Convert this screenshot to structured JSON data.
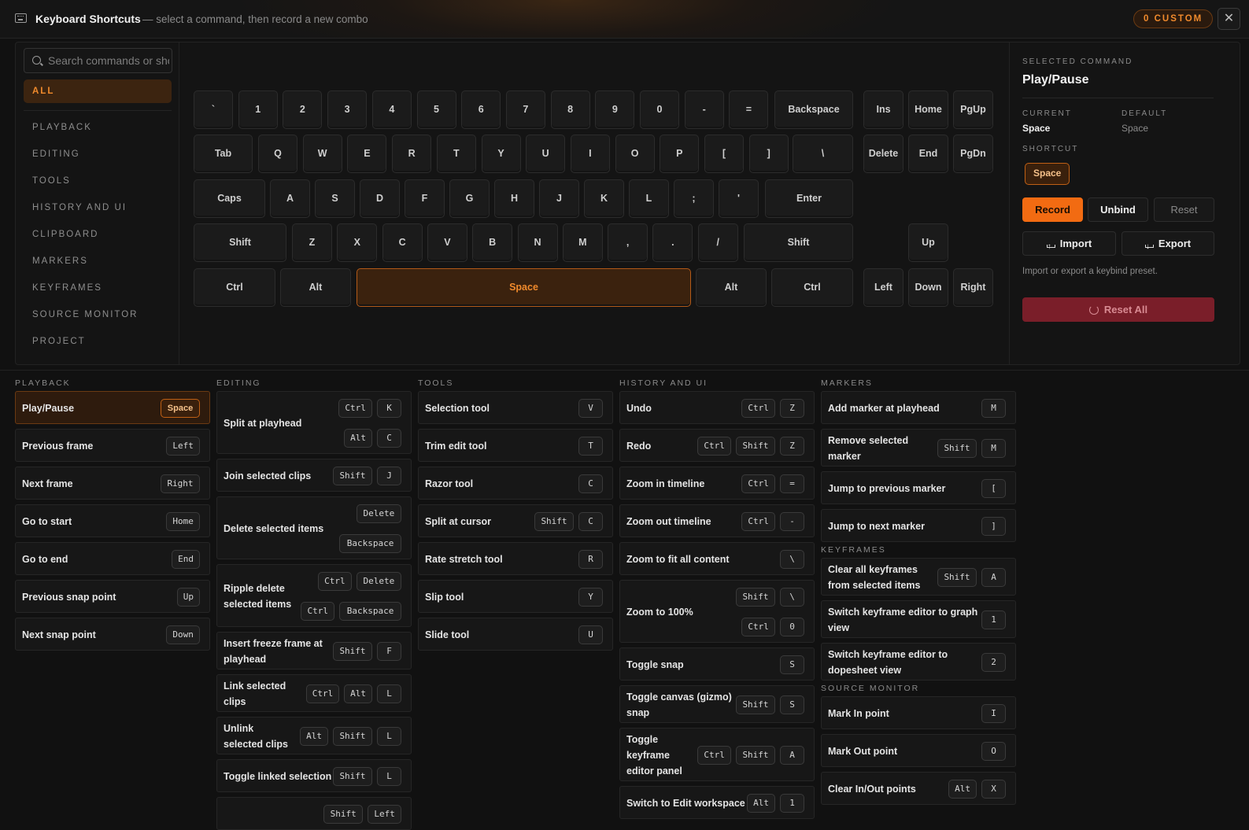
{
  "header": {
    "title": "Keyboard Shortcuts",
    "subtitle": "— select a command, then record a new combo",
    "custom_badge": "0 CUSTOM",
    "close": "✕"
  },
  "search": {
    "placeholder": "Search commands or shortcuts",
    "value": ""
  },
  "categories": [
    "ALL",
    "PLAYBACK",
    "EDITING",
    "TOOLS",
    "HISTORY AND UI",
    "CLIPBOARD",
    "MARKERS",
    "KEYFRAMES",
    "SOURCE MONITOR",
    "PROJECT"
  ],
  "keyboard": {
    "row1": [
      "`",
      "1",
      "2",
      "3",
      "4",
      "5",
      "6",
      "7",
      "8",
      "9",
      "0",
      "-",
      "=",
      "Backspace"
    ],
    "row2": [
      "Tab",
      "Q",
      "W",
      "E",
      "R",
      "T",
      "Y",
      "U",
      "I",
      "O",
      "P",
      "[",
      "]",
      "\\"
    ],
    "row3": [
      "Caps",
      "A",
      "S",
      "D",
      "F",
      "G",
      "H",
      "J",
      "K",
      "L",
      ";",
      "'",
      "Enter"
    ],
    "row4": [
      "Shift",
      "Z",
      "X",
      "C",
      "V",
      "B",
      "N",
      "M",
      ",",
      ".",
      "/",
      "Shift"
    ],
    "row5": [
      "Ctrl",
      "Alt",
      "Space",
      "Alt",
      "Ctrl"
    ],
    "nav": [
      "Ins",
      "Home",
      "PgUp",
      "Delete",
      "End",
      "PgDn"
    ],
    "arrows": [
      "Up",
      "Left",
      "Down",
      "Right"
    ],
    "highlighted_key": "Space"
  },
  "detail": {
    "selected_label": "SELECTED COMMAND",
    "name": "Play/Pause",
    "current_label": "CURRENT",
    "current_value": "Space",
    "default_label": "DEFAULT",
    "default_value": "Space",
    "shortcut_label": "SHORTCUT",
    "shortcut_value": "Space",
    "record": "Record",
    "unbind": "Unbind",
    "reset": "Reset",
    "import": "Import",
    "export": "Export",
    "helper": "Import or export a keybind preset.",
    "reset_all": "Reset All"
  },
  "lists": {
    "playback": {
      "title": "PLAYBACK",
      "items": [
        {
          "label": "Play/Pause",
          "keys": [
            "Space"
          ]
        },
        {
          "label": "Previous frame",
          "keys": [
            "Left"
          ]
        },
        {
          "label": "Next frame",
          "keys": [
            "Right"
          ]
        },
        {
          "label": "Go to start",
          "keys": [
            "Home"
          ]
        },
        {
          "label": "Go to end",
          "keys": [
            "End"
          ]
        },
        {
          "label": "Previous snap point",
          "keys": [
            "Up"
          ]
        },
        {
          "label": "Next snap point",
          "keys": [
            "Down"
          ]
        }
      ]
    },
    "editing": {
      "title": "EDITING",
      "items": [
        {
          "label": "Split at playhead",
          "keys": [
            "Ctrl",
            "K"
          ],
          "keys2": [
            "Alt",
            "C"
          ]
        },
        {
          "label": "Join selected clips",
          "keys": [
            "Shift",
            "J"
          ]
        },
        {
          "label": "Delete selected items",
          "keys": [
            "Delete"
          ],
          "keys2": [
            "Backspace"
          ]
        },
        {
          "label": "Ripple delete",
          "label2": "selected items",
          "keys": [
            "Ctrl",
            "Delete"
          ],
          "keys2": [
            "Ctrl",
            "Backspace"
          ]
        },
        {
          "label": "Insert freeze frame at",
          "label2": "playhead",
          "keys": [
            "Shift",
            "F"
          ]
        },
        {
          "label": "Link selected",
          "label2": "clips",
          "keys": [
            "Ctrl",
            "Alt",
            "L"
          ]
        },
        {
          "label": "Unlink",
          "label2": "selected clips",
          "keys": [
            "Alt",
            "Shift",
            "L"
          ]
        },
        {
          "label": "Toggle linked selection",
          "keys": [
            "Shift",
            "L"
          ]
        },
        {
          "label": "",
          "keys": [
            "Shift",
            "Left"
          ]
        }
      ]
    },
    "tools": {
      "title": "TOOLS",
      "items": [
        {
          "label": "Selection tool",
          "keys": [
            "V"
          ]
        },
        {
          "label": "Trim edit tool",
          "keys": [
            "T"
          ]
        },
        {
          "label": "Razor tool",
          "keys": [
            "C"
          ]
        },
        {
          "label": "Split at cursor",
          "keys": [
            "Shift",
            "C"
          ]
        },
        {
          "label": "Rate stretch tool",
          "keys": [
            "R"
          ]
        },
        {
          "label": "Slip tool",
          "keys": [
            "Y"
          ]
        },
        {
          "label": "Slide tool",
          "keys": [
            "U"
          ]
        }
      ]
    },
    "history": {
      "title": "HISTORY AND UI",
      "items": [
        {
          "label": "Undo",
          "keys": [
            "Ctrl",
            "Z"
          ]
        },
        {
          "label": "Redo",
          "keys": [
            "Ctrl",
            "Shift",
            "Z"
          ]
        },
        {
          "label": "Zoom in timeline",
          "keys": [
            "Ctrl",
            "="
          ]
        },
        {
          "label": "Zoom out timeline",
          "keys": [
            "Ctrl",
            "-"
          ]
        },
        {
          "label": "Zoom to fit all content",
          "keys": [
            "\\"
          ]
        },
        {
          "label": "Zoom to 100%",
          "keys": [
            "Shift",
            "\\"
          ],
          "keys2": [
            "Ctrl",
            "0"
          ]
        },
        {
          "label": "Toggle snap",
          "keys": [
            "S"
          ]
        },
        {
          "label": "Toggle canvas (gizmo)",
          "label2": "snap",
          "keys": [
            "Shift",
            "S"
          ]
        },
        {
          "label": "Toggle",
          "label2": "keyframe",
          "label3": "editor panel",
          "keys": [
            "Ctrl",
            "Shift",
            "A"
          ]
        },
        {
          "label": "Switch to Edit workspace",
          "keys": [
            "Alt",
            "1"
          ]
        }
      ]
    },
    "markers": {
      "title": "MARKERS",
      "items": [
        {
          "label": "Add marker at playhead",
          "keys": [
            "M"
          ]
        },
        {
          "label": "Remove selected",
          "label2": "marker",
          "keys": [
            "Shift",
            "M"
          ]
        },
        {
          "label": "Jump to previous marker",
          "keys": [
            "["
          ]
        },
        {
          "label": "Jump to next marker",
          "keys": [
            "]"
          ]
        }
      ]
    },
    "keyframes": {
      "title": "KEYFRAMES",
      "items": [
        {
          "label": "Clear all keyframes",
          "label2": "from selected items",
          "keys": [
            "Shift",
            "A"
          ]
        },
        {
          "label": "Switch keyframe editor to graph",
          "label2": "view",
          "keys": [
            "1"
          ]
        },
        {
          "label": "Switch keyframe editor to",
          "label2": "dopesheet view",
          "keys": [
            "2"
          ]
        }
      ]
    },
    "source_monitor": {
      "title": "SOURCE MONITOR",
      "items": [
        {
          "label": "Mark In point",
          "keys": [
            "I"
          ]
        },
        {
          "label": "Mark Out point",
          "keys": [
            "O"
          ]
        },
        {
          "label": "Clear In/Out points",
          "keys": [
            "Alt",
            "X"
          ]
        }
      ]
    }
  },
  "colors": {
    "accent": "#f26b12",
    "accent_text": "#f08a2c",
    "danger": "#7a1e29",
    "background": "#111111"
  }
}
